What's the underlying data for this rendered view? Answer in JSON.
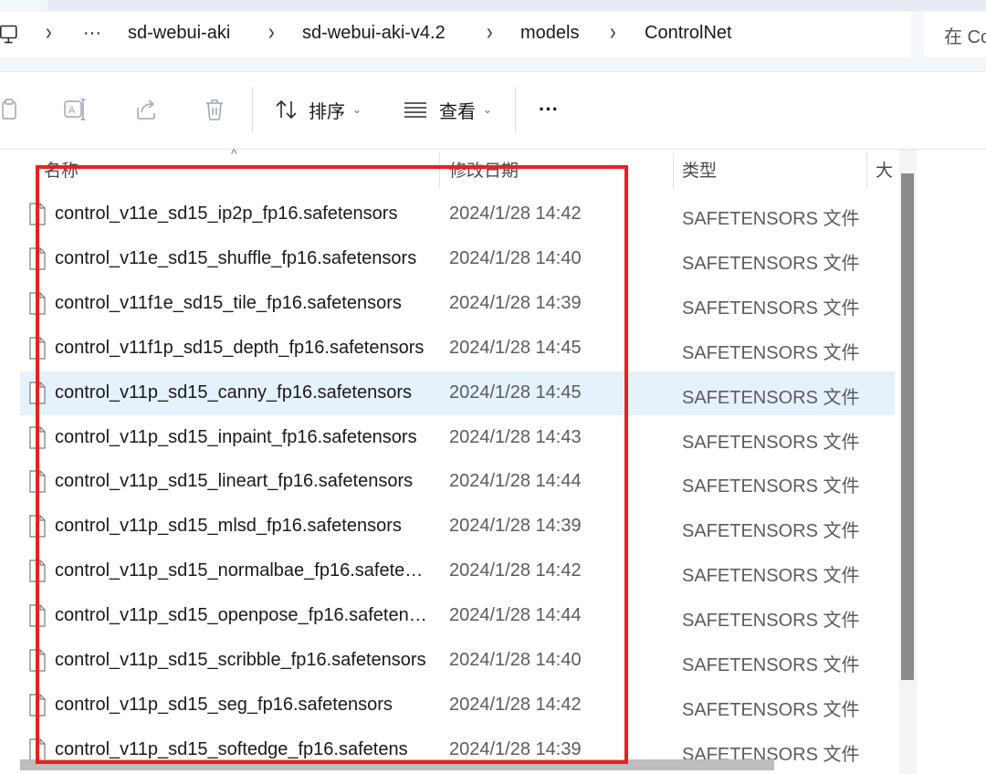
{
  "breadcrumb": {
    "items": [
      "sd-webui-aki",
      "sd-webui-aki-v4.2",
      "models",
      "ControlNet"
    ],
    "overflow_label": "···"
  },
  "search": {
    "placeholder": "在 ControlNet 中搜索"
  },
  "toolbar": {
    "sort_label": "排序",
    "view_label": "查看",
    "more_label": "···"
  },
  "columns": {
    "name": "名称",
    "modified": "修改日期",
    "type": "类型",
    "size": "大"
  },
  "files": [
    {
      "name": "control_v11e_sd15_ip2p_fp16.safetensors",
      "date": "2024/1/28 14:42",
      "type": "SAFETENSORS 文件"
    },
    {
      "name": "control_v11e_sd15_shuffle_fp16.safetensors",
      "date": "2024/1/28 14:40",
      "type": "SAFETENSORS 文件"
    },
    {
      "name": "control_v11f1e_sd15_tile_fp16.safetensors",
      "date": "2024/1/28 14:39",
      "type": "SAFETENSORS 文件"
    },
    {
      "name": "control_v11f1p_sd15_depth_fp16.safetensors",
      "date": "2024/1/28 14:45",
      "type": "SAFETENSORS 文件"
    },
    {
      "name": "control_v11p_sd15_canny_fp16.safetensors",
      "date": "2024/1/28 14:45",
      "type": "SAFETENSORS 文件",
      "selected": true
    },
    {
      "name": "control_v11p_sd15_inpaint_fp16.safetensors",
      "date": "2024/1/28 14:43",
      "type": "SAFETENSORS 文件"
    },
    {
      "name": "control_v11p_sd15_lineart_fp16.safetensors",
      "date": "2024/1/28 14:44",
      "type": "SAFETENSORS 文件"
    },
    {
      "name": "control_v11p_sd15_mlsd_fp16.safetensors",
      "date": "2024/1/28 14:39",
      "type": "SAFETENSORS 文件"
    },
    {
      "name": "control_v11p_sd15_normalbae_fp16.safeten...",
      "date": "2024/1/28 14:42",
      "type": "SAFETENSORS 文件"
    },
    {
      "name": "control_v11p_sd15_openpose_fp16.safetens...",
      "date": "2024/1/28 14:44",
      "type": "SAFETENSORS 文件"
    },
    {
      "name": "control_v11p_sd15_scribble_fp16.safetensors",
      "date": "2024/1/28 14:40",
      "type": "SAFETENSORS 文件"
    },
    {
      "name": "control_v11p_sd15_seg_fp16.safetensors",
      "date": "2024/1/28 14:42",
      "type": "SAFETENSORS 文件"
    },
    {
      "name": "control_v11p_sd15_softedge_fp16.safetens",
      "date": "2024/1/28 14:39",
      "type": "SAFETENSORS 文件"
    }
  ],
  "colors": {
    "selection": "#e5f1fb",
    "annotation": "#e8211f"
  },
  "icons": [
    "computer-icon",
    "copy-icon",
    "rename-icon",
    "share-icon",
    "delete-icon",
    "sort-icon",
    "view-icon",
    "more-icon",
    "file-icon"
  ]
}
